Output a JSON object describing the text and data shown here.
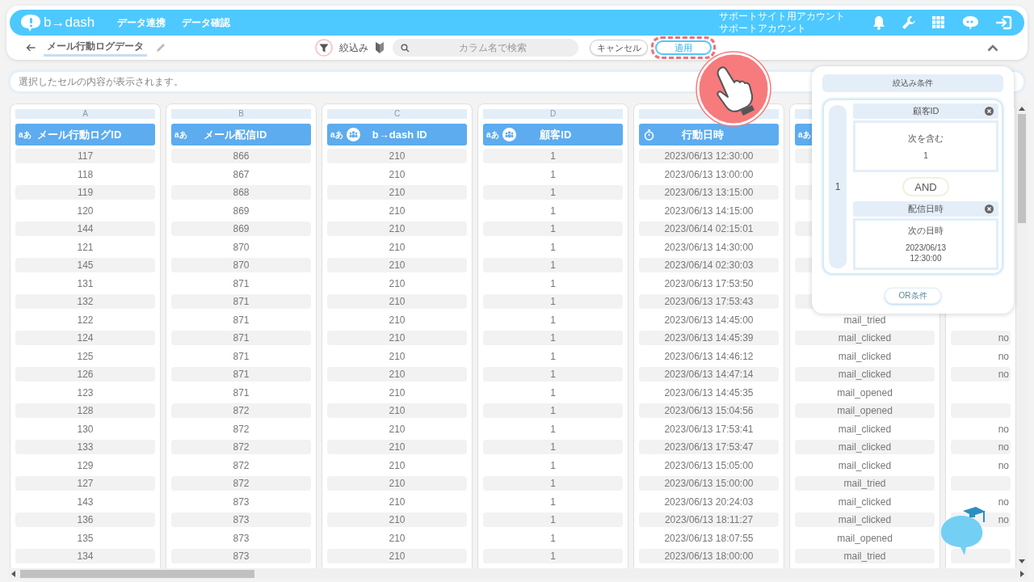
{
  "header": {
    "logo": "b→dash",
    "nav": [
      "データ連携",
      "データ確認"
    ],
    "account": [
      "サポートサイト用アカウント",
      "サポートアカウント"
    ]
  },
  "toolbar": {
    "title": "メール行動ログデータ",
    "filter_label": "絞込み",
    "search": {
      "placeholder": "カラム名で検索"
    },
    "cancel": "キャンセル",
    "apply": "適用",
    "apply_highlighted": true
  },
  "cell_viewer": {
    "placeholder": "選択したセルの内容が表示されます。"
  },
  "columns": [
    {
      "letter": "A",
      "name": "メール行動ログID",
      "kind": "text",
      "type_label": "aあ",
      "key": false
    },
    {
      "letter": "B",
      "name": "メール配信ID",
      "kind": "text",
      "type_label": "aあ",
      "key": false
    },
    {
      "letter": "C",
      "name": "b→dash ID",
      "kind": "text",
      "type_label": "aあ",
      "key": true
    },
    {
      "letter": "D",
      "name": "顧客ID",
      "kind": "text",
      "type_label": "aあ",
      "key": true
    },
    {
      "name": "行動日時",
      "kind": "datetime",
      "key": false
    },
    {
      "kind": "text",
      "type_label": "aあ"
    },
    {
      "kind": "other"
    }
  ],
  "rows": [
    [
      "117",
      "866",
      "210",
      "1",
      "2023/06/13 12:30:00",
      null,
      null
    ],
    [
      "118",
      "867",
      "210",
      "1",
      "2023/06/13 13:00:00",
      null,
      null
    ],
    [
      "119",
      "868",
      "210",
      "1",
      "2023/06/13 13:15:00",
      null,
      null
    ],
    [
      "120",
      "869",
      "210",
      "1",
      "2023/06/13 14:15:00",
      null,
      null
    ],
    [
      "144",
      "869",
      "210",
      "1",
      "2023/06/14 02:15:01",
      null,
      null
    ],
    [
      "121",
      "870",
      "210",
      "1",
      "2023/06/13 14:30:00",
      null,
      null
    ],
    [
      "145",
      "870",
      "210",
      "1",
      "2023/06/14 02:30:03",
      null,
      null
    ],
    [
      "131",
      "871",
      "210",
      "1",
      "2023/06/13 17:53:50",
      null,
      null
    ],
    [
      "132",
      "871",
      "210",
      "1",
      "2023/06/13 17:53:43",
      null,
      null
    ],
    [
      "122",
      "871",
      "210",
      "1",
      "2023/06/13 14:45:00",
      "mail_tried",
      null
    ],
    [
      "124",
      "871",
      "210",
      "1",
      "2023/06/13 14:45:39",
      "mail_clicked",
      "no"
    ],
    [
      "125",
      "871",
      "210",
      "1",
      "2023/06/13 14:46:12",
      "mail_clicked",
      "no"
    ],
    [
      "126",
      "871",
      "210",
      "1",
      "2023/06/13 14:47:14",
      "mail_clicked",
      "no"
    ],
    [
      "123",
      "871",
      "210",
      "1",
      "2023/06/13 14:45:35",
      "mail_opened",
      null
    ],
    [
      "128",
      "872",
      "210",
      "1",
      "2023/06/13 15:04:56",
      "mail_opened",
      null
    ],
    [
      "130",
      "872",
      "210",
      "1",
      "2023/06/13 17:53:41",
      "mail_clicked",
      "no"
    ],
    [
      "133",
      "872",
      "210",
      "1",
      "2023/06/13 17:53:47",
      "mail_clicked",
      "no"
    ],
    [
      "129",
      "872",
      "210",
      "1",
      "2023/06/13 15:05:00",
      "mail_clicked",
      "no"
    ],
    [
      "127",
      "872",
      "210",
      "1",
      "2023/06/13 15:00:00",
      "mail_tried",
      null
    ],
    [
      "143",
      "873",
      "210",
      "1",
      "2023/06/13 20:24:03",
      "mail_clicked",
      "no"
    ],
    [
      "136",
      "873",
      "210",
      "1",
      "2023/06/13 18:11:27",
      "mail_clicked",
      "no"
    ],
    [
      "135",
      "873",
      "210",
      "1",
      "2023/06/13 18:07:55",
      "mail_opened",
      null
    ],
    [
      "134",
      "873",
      "210",
      "1",
      "2023/06/13 18:00:00",
      "mail_tried",
      null
    ]
  ],
  "filter_panel": {
    "title": "絞込み条件",
    "groups": [
      {
        "number": "1",
        "joiner": "AND",
        "conditions": [
          {
            "field": "顧客ID",
            "operator": "次を含む",
            "value": "1"
          },
          {
            "field": "配信日時",
            "operator": "次の日時",
            "value": "2023/06/13 12:30:00"
          }
        ]
      }
    ],
    "or_button": "OR条件"
  }
}
